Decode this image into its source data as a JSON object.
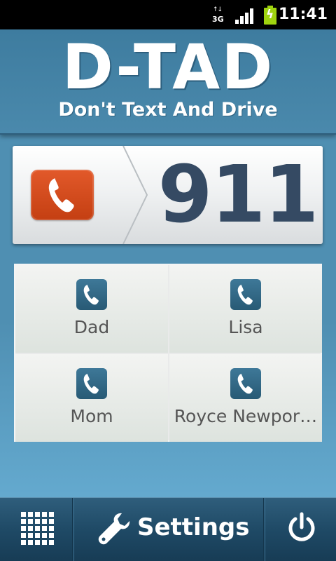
{
  "status_bar": {
    "network_type": "3G",
    "time": "11:41"
  },
  "header": {
    "logo": "D-TAD",
    "tagline": "Don't Text And Drive"
  },
  "emergency": {
    "number": "911",
    "icon": "phone-icon",
    "accent_color": "#d54c1e"
  },
  "contacts": [
    {
      "name": "Dad",
      "icon": "phone-icon"
    },
    {
      "name": "Lisa",
      "icon": "phone-icon"
    },
    {
      "name": "Mom",
      "icon": "phone-icon"
    },
    {
      "name": "Royce Newpor…",
      "icon": "phone-icon"
    }
  ],
  "bottom_bar": {
    "apps_icon": "grid-icon",
    "settings_icon": "wrench-icon",
    "settings_label": "Settings",
    "power_icon": "power-icon"
  }
}
